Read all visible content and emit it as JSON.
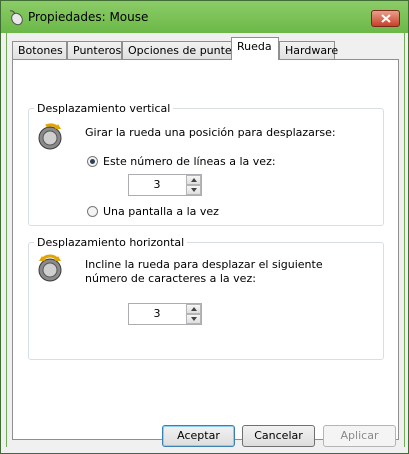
{
  "window": {
    "title": "Propiedades: Mouse"
  },
  "tabs": [
    {
      "label": "Botones"
    },
    {
      "label": "Punteros"
    },
    {
      "label": "Opciones de puntero"
    },
    {
      "label": "Rueda",
      "active": true
    },
    {
      "label": "Hardware"
    }
  ],
  "vertical": {
    "title": "Desplazamiento vertical",
    "instruction": "Girar la rueda una posición para desplazarse:",
    "option_lines": "Este número de líneas a la vez:",
    "option_lines_selected": true,
    "lines_value": "3",
    "option_page": "Una pantalla a la vez",
    "option_page_selected": false
  },
  "horizontal": {
    "title": "Desplazamiento horizontal",
    "instruction_line1": "Incline la rueda para desplazar el siguiente",
    "instruction_line2": "número de caracteres a la vez:",
    "chars_value": "3"
  },
  "buttons": {
    "ok": "Aceptar",
    "cancel": "Cancelar",
    "apply": "Aplicar",
    "apply_enabled": false
  },
  "icons": {
    "title": "mouse-icon",
    "wheel": "mouse-wheel-icon",
    "close": "close-icon"
  }
}
